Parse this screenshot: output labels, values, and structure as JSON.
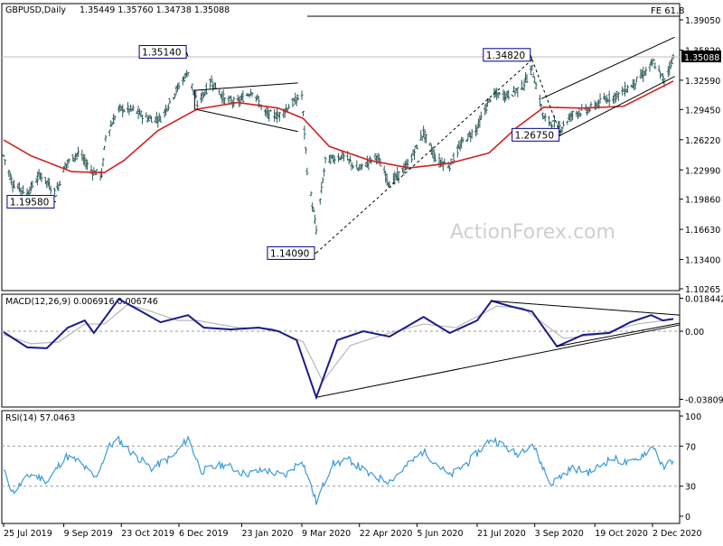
{
  "colors": {
    "background": "#ffffff",
    "price_bars": "#2e5c5c",
    "moving_average": "#d42020",
    "macd_line": "#1a1a8c",
    "signal_line": "#b8b8b8",
    "rsi_line": "#3b9bdb",
    "trendline": "#000000",
    "panel_border": "#000000",
    "label_box_border": "#00008b",
    "label_text": "#000000",
    "hline_current": "#bbbbbb",
    "watermark": "#cfcfcf"
  },
  "watermark": "ActionForex.com",
  "header": {
    "symbol_label": "GBPUSD,Daily",
    "ohlc_label": "1.35449 1.35760 1.34738 1.35088"
  },
  "macd_header": "MACD(12,26,9) 0.006916 0.006746",
  "rsi_header": "RSI(14) 57.0463",
  "fe_label": "FE 61.8",
  "current_price_label": "1.35088",
  "x_axis_labels": [
    "25 Jul 2019",
    "9 Sep 2019",
    "23 Oct 2019",
    "6 Dec 2019",
    "23 Jan 2020",
    "9 Mar 2020",
    "22 Apr 2020",
    "5 Jun 2020",
    "21 Jul 2020",
    "3 Sep 2020",
    "19 Oct 2020",
    "2 Dec 2020"
  ],
  "price_axis_labels": [
    "1.39050",
    "1.35820",
    "1.32590",
    "1.29450",
    "1.26220",
    "1.22990",
    "1.19860",
    "1.16630",
    "1.13400",
    "1.10265"
  ],
  "macd_axis_labels": [
    "0.018442",
    "0.00",
    "-0.038095"
  ],
  "rsi_axis_labels": [
    "100",
    "70",
    "30",
    "0"
  ],
  "price_annotations": [
    {
      "text": "1.35140",
      "date": "2019-12-13",
      "price": 1.3514,
      "side": "left"
    },
    {
      "text": "1.19580",
      "date": "2019-09-03",
      "price": 1.1958,
      "side": "left"
    },
    {
      "text": "1.14090",
      "date": "2020-03-20",
      "price": 1.1409,
      "side": "left"
    },
    {
      "text": "1.34820",
      "date": "2020-09-01",
      "price": 1.3482,
      "side": "left"
    },
    {
      "text": "1.26750",
      "date": "2020-09-23",
      "price": 1.2675,
      "side": "left"
    }
  ],
  "chart_data": [
    {
      "type": "line",
      "subtype": "ohlc-bars with moving average",
      "title": "GBPUSD,Daily",
      "x_range": [
        "2019-07-25",
        "2020-12-18"
      ],
      "ylim": [
        1.10265,
        1.3905
      ],
      "grid": false,
      "series": [
        {
          "points": [
            [
              "2019-07-25",
              1.245
            ],
            [
              "2019-08-01",
              1.215
            ],
            [
              "2019-08-12",
              1.205
            ],
            [
              "2019-08-22",
              1.225
            ],
            [
              "2019-09-03",
              1.205
            ],
            [
              "2019-09-10",
              1.235
            ],
            [
              "2019-09-20",
              1.248
            ],
            [
              "2019-10-01",
              1.228
            ],
            [
              "2019-10-08",
              1.225
            ],
            [
              "2019-10-11",
              1.265
            ],
            [
              "2019-10-21",
              1.295
            ],
            [
              "2019-11-01",
              1.294
            ],
            [
              "2019-11-12",
              1.285
            ],
            [
              "2019-11-22",
              1.285
            ],
            [
              "2019-12-04",
              1.315
            ],
            [
              "2019-12-13",
              1.335
            ],
            [
              "2019-12-20",
              1.3
            ],
            [
              "2019-12-31",
              1.325
            ],
            [
              "2020-01-10",
              1.305
            ],
            [
              "2020-01-20",
              1.302
            ],
            [
              "2020-01-31",
              1.315
            ],
            [
              "2020-02-10",
              1.29
            ],
            [
              "2020-02-20",
              1.288
            ],
            [
              "2020-03-09",
              1.31
            ],
            [
              "2020-03-13",
              1.23
            ],
            [
              "2020-03-20",
              1.165
            ],
            [
              "2020-03-27",
              1.24
            ],
            [
              "2020-04-10",
              1.245
            ],
            [
              "2020-04-21",
              1.23
            ],
            [
              "2020-05-05",
              1.245
            ],
            [
              "2020-05-15",
              1.215
            ],
            [
              "2020-05-29",
              1.235
            ],
            [
              "2020-06-10",
              1.27
            ],
            [
              "2020-06-20",
              1.24
            ],
            [
              "2020-06-30",
              1.235
            ],
            [
              "2020-07-10",
              1.26
            ],
            [
              "2020-07-21",
              1.275
            ],
            [
              "2020-08-01",
              1.31
            ],
            [
              "2020-08-14",
              1.31
            ],
            [
              "2020-08-25",
              1.32
            ],
            [
              "2020-09-01",
              1.338
            ],
            [
              "2020-09-10",
              1.285
            ],
            [
              "2020-09-23",
              1.275
            ],
            [
              "2020-10-02",
              1.29
            ],
            [
              "2020-10-15",
              1.295
            ],
            [
              "2020-10-26",
              1.305
            ],
            [
              "2020-11-05",
              1.31
            ],
            [
              "2020-11-16",
              1.32
            ],
            [
              "2020-11-27",
              1.335
            ],
            [
              "2020-12-03",
              1.345
            ],
            [
              "2020-12-11",
              1.325
            ],
            [
              "2020-12-18",
              1.351
            ]
          ]
        },
        {
          "points": [
            [
              "2019-07-25",
              1.262
            ],
            [
              "2019-08-15",
              1.245
            ],
            [
              "2019-09-15",
              1.228
            ],
            [
              "2019-10-10",
              1.227
            ],
            [
              "2019-10-25",
              1.24
            ],
            [
              "2019-11-20",
              1.272
            ],
            [
              "2019-12-20",
              1.295
            ],
            [
              "2020-01-20",
              1.302
            ],
            [
              "2020-02-20",
              1.296
            ],
            [
              "2020-03-10",
              1.285
            ],
            [
              "2020-03-30",
              1.255
            ],
            [
              "2020-04-30",
              1.24
            ],
            [
              "2020-05-30",
              1.232
            ],
            [
              "2020-06-30",
              1.237
            ],
            [
              "2020-07-30",
              1.248
            ],
            [
              "2020-08-20",
              1.275
            ],
            [
              "2020-09-10",
              1.297
            ],
            [
              "2020-10-10",
              1.296
            ],
            [
              "2020-11-10",
              1.298
            ],
            [
              "2020-12-18",
              1.325
            ]
          ]
        }
      ]
    },
    {
      "type": "line",
      "title": "MACD(12,26,9) 0.006916 0.006746",
      "x_range": [
        "2019-07-25",
        "2020-12-18"
      ],
      "ylim": [
        -0.04,
        0.02
      ],
      "series": [
        {
          "points": [
            [
              "2019-07-25",
              -0.0005
            ],
            [
              "2019-08-12",
              -0.009
            ],
            [
              "2019-08-27",
              -0.0095
            ],
            [
              "2019-09-12",
              0.002
            ],
            [
              "2019-09-25",
              0.006
            ],
            [
              "2019-10-02",
              -0.001
            ],
            [
              "2019-10-21",
              0.018
            ],
            [
              "2019-11-05",
              0.012
            ],
            [
              "2019-11-22",
              0.005
            ],
            [
              "2019-12-13",
              0.009
            ],
            [
              "2019-12-25",
              0.002
            ],
            [
              "2020-01-15",
              0.001
            ],
            [
              "2020-02-05",
              0.002
            ],
            [
              "2020-02-20",
              0.0
            ],
            [
              "2020-03-05",
              -0.005
            ],
            [
              "2020-03-20",
              -0.037
            ],
            [
              "2020-04-05",
              -0.005
            ],
            [
              "2020-04-25",
              0.0
            ],
            [
              "2020-05-15",
              -0.003
            ],
            [
              "2020-06-10",
              0.008
            ],
            [
              "2020-06-30",
              -0.001
            ],
            [
              "2020-07-21",
              0.006
            ],
            [
              "2020-08-01",
              0.017
            ],
            [
              "2020-08-15",
              0.014
            ],
            [
              "2020-09-01",
              0.011
            ],
            [
              "2020-09-20",
              -0.0085
            ],
            [
              "2020-10-10",
              -0.002
            ],
            [
              "2020-10-30",
              -0.001
            ],
            [
              "2020-11-15",
              0.005
            ],
            [
              "2020-12-01",
              0.009
            ],
            [
              "2020-12-10",
              0.006
            ],
            [
              "2020-12-18",
              0.0069
            ]
          ]
        },
        {
          "points": [
            [
              "2019-07-25",
              -0.002
            ],
            [
              "2019-08-15",
              -0.007
            ],
            [
              "2019-09-05",
              -0.006
            ],
            [
              "2019-09-25",
              0.004
            ],
            [
              "2019-10-10",
              0.004
            ],
            [
              "2019-10-28",
              0.015
            ],
            [
              "2019-11-15",
              0.011
            ],
            [
              "2019-12-05",
              0.006
            ],
            [
              "2019-12-20",
              0.006
            ],
            [
              "2020-01-20",
              0.002
            ],
            [
              "2020-02-15",
              0.0015
            ],
            [
              "2020-03-10",
              -0.006
            ],
            [
              "2020-03-25",
              -0.028
            ],
            [
              "2020-04-15",
              -0.008
            ],
            [
              "2020-05-10",
              -0.002
            ],
            [
              "2020-06-10",
              0.004
            ],
            [
              "2020-07-05",
              0.002
            ],
            [
              "2020-08-05",
              0.014
            ],
            [
              "2020-08-25",
              0.013
            ],
            [
              "2020-09-25",
              -0.004
            ],
            [
              "2020-10-20",
              -0.002
            ],
            [
              "2020-11-20",
              0.004
            ],
            [
              "2020-12-18",
              0.0067
            ]
          ]
        }
      ]
    },
    {
      "type": "line",
      "title": "RSI(14) 57.0463",
      "x_range": [
        "2019-07-25",
        "2020-12-18"
      ],
      "ylim": [
        0,
        100
      ],
      "reference_levels": [
        70,
        30
      ],
      "series": [
        {
          "points": [
            [
              "2019-07-25",
              45
            ],
            [
              "2019-08-01",
              24
            ],
            [
              "2019-08-15",
              42
            ],
            [
              "2019-08-28",
              35
            ],
            [
              "2019-09-10",
              60
            ],
            [
              "2019-09-20",
              55
            ],
            [
              "2019-10-03",
              38
            ],
            [
              "2019-10-14",
              70
            ],
            [
              "2019-10-21",
              76
            ],
            [
              "2019-11-01",
              62
            ],
            [
              "2019-11-15",
              48
            ],
            [
              "2019-12-02",
              60
            ],
            [
              "2019-12-13",
              78
            ],
            [
              "2019-12-23",
              45
            ],
            [
              "2020-01-10",
              52
            ],
            [
              "2020-01-25",
              42
            ],
            [
              "2020-02-10",
              46
            ],
            [
              "2020-02-25",
              40
            ],
            [
              "2020-03-09",
              57
            ],
            [
              "2020-03-20",
              14
            ],
            [
              "2020-04-01",
              52
            ],
            [
              "2020-04-15",
              56
            ],
            [
              "2020-05-01",
              40
            ],
            [
              "2020-05-15",
              35
            ],
            [
              "2020-06-10",
              65
            ],
            [
              "2020-06-30",
              40
            ],
            [
              "2020-07-15",
              55
            ],
            [
              "2020-08-01",
              78
            ],
            [
              "2020-08-20",
              62
            ],
            [
              "2020-09-01",
              73
            ],
            [
              "2020-09-15",
              32
            ],
            [
              "2020-10-01",
              48
            ],
            [
              "2020-10-15",
              44
            ],
            [
              "2020-11-01",
              58
            ],
            [
              "2020-11-15",
              52
            ],
            [
              "2020-12-03",
              70
            ],
            [
              "2020-12-10",
              48
            ],
            [
              "2020-12-18",
              57
            ]
          ]
        }
      ]
    }
  ]
}
